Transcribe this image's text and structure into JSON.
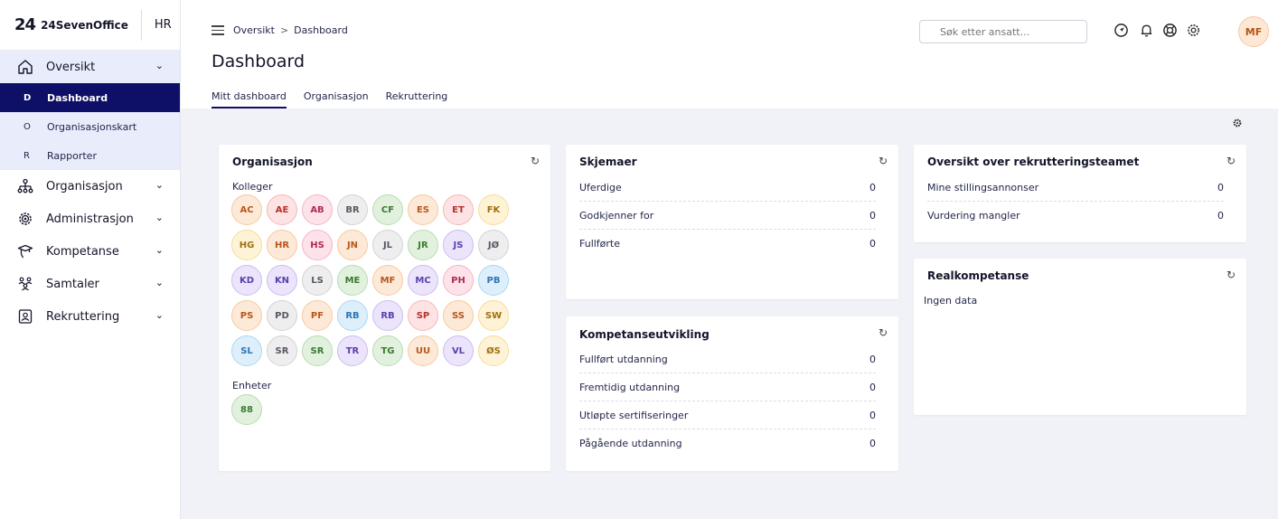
{
  "sidebar": {
    "brand_mark": "24",
    "brand_name": "24SevenOffice",
    "module": "HR",
    "groups": [
      {
        "label": "Oversikt"
      },
      {
        "label": "Organisasjon"
      },
      {
        "label": "Administrasjon"
      },
      {
        "label": "Kompetanse"
      },
      {
        "label": "Samtaler"
      },
      {
        "label": "Rekruttering"
      }
    ],
    "subitems": [
      {
        "letter": "D",
        "label": "Dashboard"
      },
      {
        "letter": "O",
        "label": "Organisasjonskart"
      },
      {
        "letter": "R",
        "label": "Rapporter"
      }
    ]
  },
  "header": {
    "breadcrumb": [
      "Oversikt",
      "Dashboard"
    ],
    "breadcrumb_sep": ">",
    "search_placeholder": "Søk etter ansatt...",
    "avatar": "MF",
    "title": "Dashboard",
    "tabs": [
      "Mitt dashboard",
      "Organisasjon",
      "Rekruttering"
    ]
  },
  "icons": {
    "refresh": "refresh-icon",
    "settings": "gear-icon"
  },
  "organisasjon": {
    "title": "Organisasjon",
    "kolleger_label": "Kolleger",
    "enheter_label": "Enheter",
    "enheter_icon": "88",
    "colleagues": [
      {
        "initials": "AC",
        "color": "orange"
      },
      {
        "initials": "AE",
        "color": "red"
      },
      {
        "initials": "AB",
        "color": "pink"
      },
      {
        "initials": "BR",
        "color": "gray"
      },
      {
        "initials": "CF",
        "color": "green"
      },
      {
        "initials": "ES",
        "color": "orange"
      },
      {
        "initials": "ET",
        "color": "red"
      },
      {
        "initials": "FK",
        "color": "yellow"
      },
      {
        "initials": "HG",
        "color": "yellow"
      },
      {
        "initials": "HR",
        "color": "orange"
      },
      {
        "initials": "HS",
        "color": "pink"
      },
      {
        "initials": "JN",
        "color": "orange"
      },
      {
        "initials": "JL",
        "color": "gray"
      },
      {
        "initials": "JR",
        "color": "green"
      },
      {
        "initials": "JS",
        "color": "purple"
      },
      {
        "initials": "JØ",
        "color": "gray"
      },
      {
        "initials": "KD",
        "color": "purple"
      },
      {
        "initials": "KN",
        "color": "purple"
      },
      {
        "initials": "LS",
        "color": "gray"
      },
      {
        "initials": "ME",
        "color": "green"
      },
      {
        "initials": "MF",
        "color": "orange"
      },
      {
        "initials": "MC",
        "color": "purple"
      },
      {
        "initials": "PH",
        "color": "pink"
      },
      {
        "initials": "PB",
        "color": "blue"
      },
      {
        "initials": "PS",
        "color": "orange"
      },
      {
        "initials": "PD",
        "color": "gray"
      },
      {
        "initials": "PF",
        "color": "orange"
      },
      {
        "initials": "RB",
        "color": "blue"
      },
      {
        "initials": "RB",
        "color": "purple"
      },
      {
        "initials": "SP",
        "color": "red"
      },
      {
        "initials": "SS",
        "color": "orange"
      },
      {
        "initials": "SW",
        "color": "yellow"
      },
      {
        "initials": "SL",
        "color": "blue"
      },
      {
        "initials": "SR",
        "color": "gray"
      },
      {
        "initials": "SR",
        "color": "green"
      },
      {
        "initials": "TR",
        "color": "purple"
      },
      {
        "initials": "TG",
        "color": "green"
      },
      {
        "initials": "UU",
        "color": "orange"
      },
      {
        "initials": "VL",
        "color": "purple"
      },
      {
        "initials": "ØS",
        "color": "yellow"
      }
    ]
  },
  "skjemaer": {
    "title": "Skjemaer",
    "rows": [
      {
        "label": "Uferdige",
        "value": "0"
      },
      {
        "label": "Godkjenner for",
        "value": "0"
      },
      {
        "label": "Fullførte",
        "value": "0"
      }
    ]
  },
  "kompetanse": {
    "title": "Kompetanseutvikling",
    "rows": [
      {
        "label": "Fullført utdanning",
        "value": "0"
      },
      {
        "label": "Fremtidig utdanning",
        "value": "0"
      },
      {
        "label": "Utløpte sertifiseringer",
        "value": "0"
      },
      {
        "label": "Pågående utdanning",
        "value": "0"
      }
    ]
  },
  "rekruttering": {
    "title": "Oversikt over rekrutteringsteamet",
    "rows": [
      {
        "label": "Mine stillingsannonser",
        "value": "0"
      },
      {
        "label": "Vurdering mangler",
        "value": "0"
      }
    ]
  },
  "realkompetanse": {
    "title": "Realkompetanse",
    "text": "Ingen data"
  },
  "palette": {
    "orange": {
      "bg": "#fde9d8",
      "border": "#f7c9a1",
      "fg": "#b9561b"
    },
    "red": {
      "bg": "#fde3e3",
      "border": "#f4b8b8",
      "fg": "#b8302f"
    },
    "pink": {
      "bg": "#fde2ea",
      "border": "#f2b5c7",
      "fg": "#b02a57"
    },
    "gray": {
      "bg": "#eeeeef",
      "border": "#d3d3d6",
      "fg": "#575863"
    },
    "green": {
      "bg": "#e1f1de",
      "border": "#b8dcb1",
      "fg": "#3b7a2f"
    },
    "yellow": {
      "bg": "#fef3d6",
      "border": "#f6dc9c",
      "fg": "#a06f10"
    },
    "purple": {
      "bg": "#ebe4fb",
      "border": "#cbbdf2",
      "fg": "#5b3fae"
    },
    "blue": {
      "bg": "#ddeffb",
      "border": "#acd6f1",
      "fg": "#2f76b0"
    }
  }
}
